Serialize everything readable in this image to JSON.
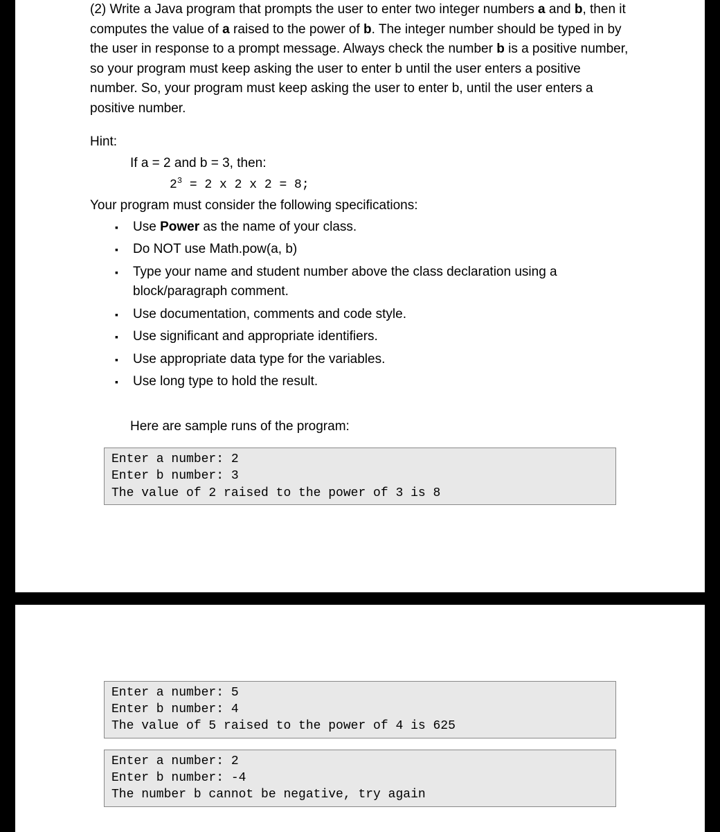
{
  "problem": {
    "number": "(2)",
    "intro_p1": "Write a Java program that prompts the user to enter two integer numbers ",
    "a": "a",
    "and": " and ",
    "b": "b",
    "intro_p2": ", then it computes the value of ",
    "a2": "a",
    "intro_p3": " raised to the power of ",
    "b2": "b",
    "intro_p4": ". The integer number should be typed in by the user in response to a prompt message. Always check the number ",
    "b3": "b",
    "intro_p5": " is a positive number, so your program must keep asking the user to enter b until the user enters a positive number. So, your program must keep asking the user to enter b, until the user enters a positive number."
  },
  "hint": {
    "label": "Hint:",
    "if_line": "If a = 2 and b = 3, then:",
    "calc_base": "2",
    "calc_exp": "3",
    "calc_rest": " = 2 x 2 x 2 = 8;",
    "specs_intro": "Your program must consider the following specifications:"
  },
  "specs": {
    "s1a": "Use ",
    "s1b": "Power",
    "s1c": " as the name of your class.",
    "s2": "Do NOT use Math.pow(a, b)",
    "s3": "Type your name and student number above the class declaration using a block/paragraph comment.",
    "s4": "Use documentation, comments and code style.",
    "s5": "Use significant and appropriate identifiers.",
    "s6": "Use appropriate data type for the variables.",
    "s7": "Use long type to hold the result."
  },
  "sample_label": "Here are sample runs of the program:",
  "samples": {
    "run1": "Enter a number: 2\nEnter b number: 3\nThe value of 2 raised to the power of 3 is 8",
    "run2": "Enter a number: 5\nEnter b number: 4\nThe value of 5 raised to the power of 4 is 625",
    "run3": "Enter a number: 2\nEnter b number: -4\nThe number b cannot be negative, try again"
  }
}
